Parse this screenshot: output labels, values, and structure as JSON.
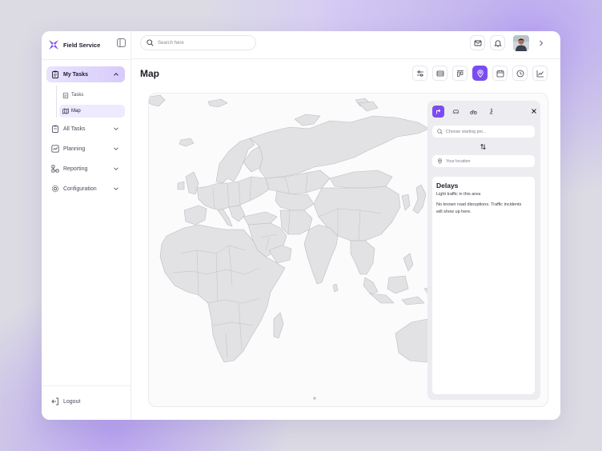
{
  "brand": {
    "name": "Field Service"
  },
  "search": {
    "placeholder": "Search here"
  },
  "sidebar": {
    "items": [
      {
        "label": "My Tasks",
        "icon": "clipboard-icon",
        "active": true,
        "expanded": true
      },
      {
        "label": "All Tasks",
        "icon": "clipboard-icon"
      },
      {
        "label": "Planning",
        "icon": "chart-icon"
      },
      {
        "label": "Reporting",
        "icon": "report-icon"
      },
      {
        "label": "Configuration",
        "icon": "gear-icon"
      }
    ],
    "subitems": [
      {
        "label": "Tasks",
        "icon": "clipboard-icon"
      },
      {
        "label": "Map",
        "icon": "map-icon",
        "active": true
      }
    ],
    "logout": "Logout"
  },
  "header": {
    "title": "Map"
  },
  "toolbar": {
    "buttons": [
      "sliders-icon",
      "list-icon",
      "board-icon",
      "location-pin-icon",
      "calendar-icon",
      "clock-icon",
      "line-chart-icon"
    ],
    "active": "location-pin-icon"
  },
  "route": {
    "modes": [
      "directions-icon",
      "car-icon",
      "bike-icon",
      "walk-icon"
    ],
    "active_mode": "directions-icon",
    "start_placeholder": "Choose starting poi...",
    "destination": "Your location",
    "delays": {
      "title": "Delays",
      "subtitle": "Light traffic in this area",
      "text": "No known road disruptions. Traffic incidents will show up here."
    }
  },
  "colors": {
    "accent": "#7b4cf0",
    "accent_light": "#e9e3ff",
    "land": "#e2e2e5",
    "border": "#bcbcc2"
  }
}
